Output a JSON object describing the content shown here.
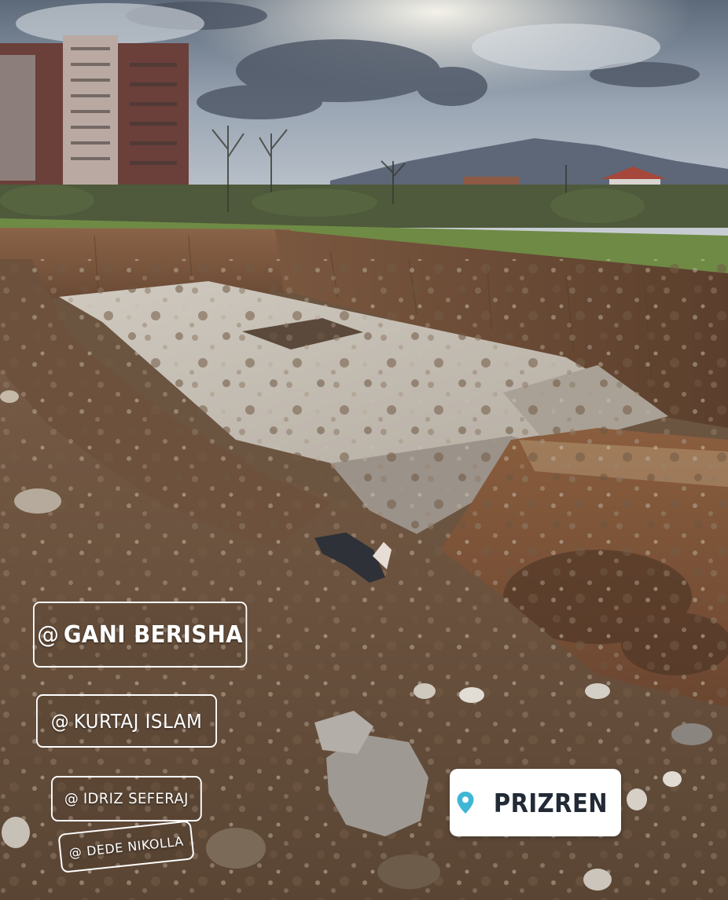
{
  "mentions": [
    {
      "at": "@",
      "name": "GANI BERISHA"
    },
    {
      "at": "@",
      "name": "KURTAJ ISLAM"
    },
    {
      "at": "@",
      "name": "IDRIZ SEFERAJ"
    },
    {
      "at": "@",
      "name": "DEDE NIKOLLA"
    }
  ],
  "location": {
    "label": "PRIZREN",
    "icon": "location-pin-icon",
    "pin_color": "#3fb6d4"
  }
}
